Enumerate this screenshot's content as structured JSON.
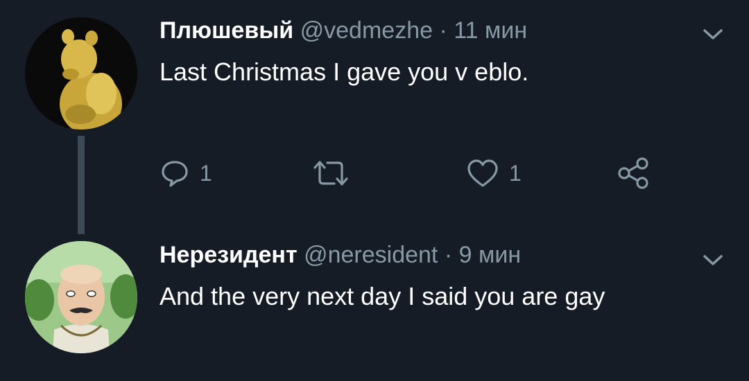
{
  "tweets": [
    {
      "author_name": "Плюшевый",
      "handle": "@vedmezhe",
      "separator": "·",
      "time": "11 мин",
      "text": "Last Christmas I gave you v eblo.",
      "replies": "1",
      "likes": "1",
      "avatar": "yellow-bear-avatar"
    },
    {
      "author_name": "Нерезидент",
      "handle": "@neresident",
      "separator": "·",
      "time": "9 мин",
      "text": "And the very next day I said you are gay",
      "avatar": "cartoon-man-avatar"
    }
  ],
  "colors": {
    "background": "#151c26",
    "muted": "#8899a6",
    "thread_line": "#3d4957",
    "text": "#ffffff"
  },
  "icons": [
    "reply-icon",
    "retweet-icon",
    "like-icon",
    "share-icon",
    "chevron-down-icon"
  ]
}
